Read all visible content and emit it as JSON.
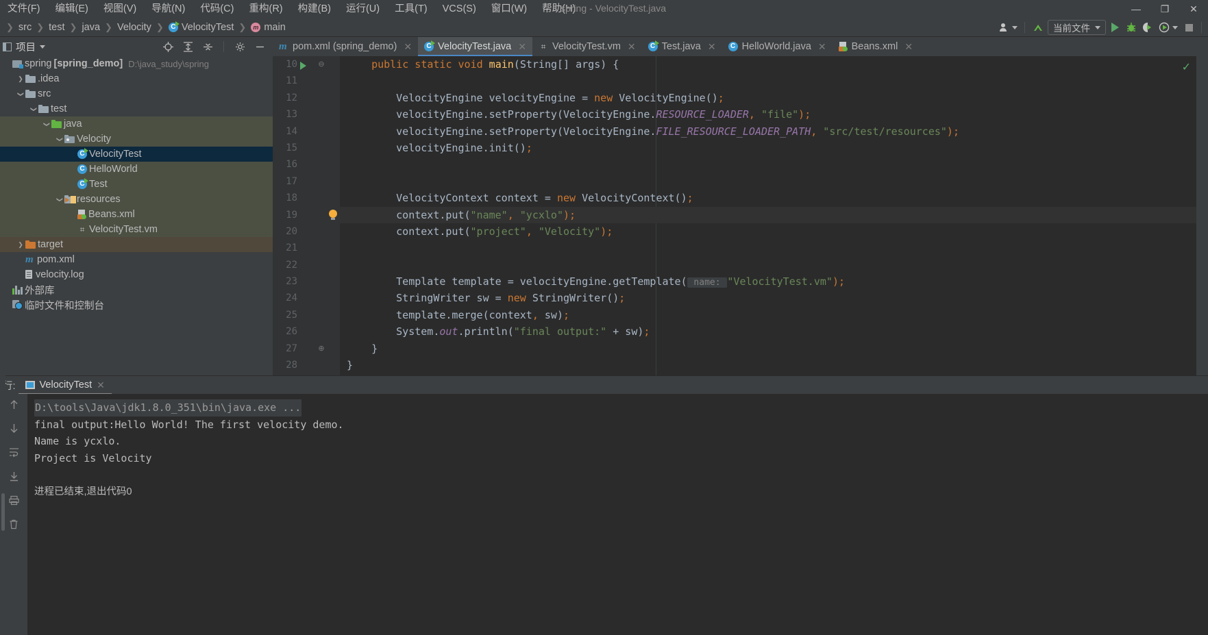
{
  "window": {
    "title": "spring - VelocityTest.java",
    "minimize": "—",
    "maximize": "❐",
    "close": "✕"
  },
  "menubar": [
    {
      "label": "文件(F)"
    },
    {
      "label": "编辑(E)"
    },
    {
      "label": "视图(V)"
    },
    {
      "label": "导航(N)"
    },
    {
      "label": "代码(C)"
    },
    {
      "label": "重构(R)"
    },
    {
      "label": "构建(B)"
    },
    {
      "label": "运行(U)"
    },
    {
      "label": "工具(T)"
    },
    {
      "label": "VCS(S)"
    },
    {
      "label": "窗口(W)"
    },
    {
      "label": "帮助(H)"
    }
  ],
  "breadcrumb": [
    {
      "label": "src",
      "icon": "none"
    },
    {
      "label": "test",
      "icon": "none"
    },
    {
      "label": "java",
      "icon": "none"
    },
    {
      "label": "Velocity",
      "icon": "none"
    },
    {
      "label": "VelocityTest",
      "icon": "class-icon"
    },
    {
      "label": "main",
      "icon": "method-icon"
    }
  ],
  "toolbar": {
    "run_config": "当前文件",
    "buttons": [
      {
        "name": "account-icon",
        "glyph": "♟"
      },
      {
        "name": "update-project-icon",
        "glyph": "↖"
      },
      {
        "name": "run-button",
        "glyph": "▶"
      },
      {
        "name": "debug-button",
        "glyph": "⚙"
      },
      {
        "name": "run-with-coverage-button",
        "glyph": "◑"
      },
      {
        "name": "profiler-button",
        "glyph": "◴"
      },
      {
        "name": "stop-button",
        "glyph": "■"
      }
    ]
  },
  "project_panel": {
    "title": "项目",
    "tree": [
      {
        "label": "spring",
        "bold_label": "[spring_demo]",
        "path": "D:\\java_study\\spring",
        "indent": 0,
        "arrow": "none",
        "icon": "project-root-icon",
        "state": "normal"
      },
      {
        "label": ".idea",
        "indent": 1,
        "arrow": "closed",
        "icon": "folder-icon",
        "state": "normal"
      },
      {
        "label": "src",
        "indent": 1,
        "arrow": "open",
        "icon": "folder-icon",
        "state": "normal"
      },
      {
        "label": "test",
        "indent": 2,
        "arrow": "open",
        "icon": "folder-icon",
        "state": "normal"
      },
      {
        "label": "java",
        "indent": 3,
        "arrow": "open",
        "icon": "folder-green-icon",
        "state": "green"
      },
      {
        "label": "Velocity",
        "indent": 4,
        "arrow": "open",
        "icon": "package-icon",
        "state": "green"
      },
      {
        "label": "VelocityTest",
        "indent": 5,
        "arrow": "none",
        "icon": "class-runnable-icon",
        "state": "selected"
      },
      {
        "label": "HelloWorld",
        "indent": 5,
        "arrow": "none",
        "icon": "class-icon",
        "state": "green"
      },
      {
        "label": "Test",
        "indent": 5,
        "arrow": "none",
        "icon": "class-runnable-icon",
        "state": "green"
      },
      {
        "label": "resources",
        "indent": 4,
        "arrow": "open",
        "icon": "resources-folder-icon",
        "state": "green"
      },
      {
        "label": "Beans.xml",
        "indent": 5,
        "arrow": "none",
        "icon": "spring-xml-icon",
        "state": "green"
      },
      {
        "label": "VelocityTest.vm",
        "indent": 5,
        "arrow": "none",
        "icon": "velocity-file-icon",
        "state": "green"
      },
      {
        "label": "target",
        "indent": 1,
        "arrow": "closed",
        "icon": "folder-orange-icon",
        "state": "brown"
      },
      {
        "label": "pom.xml",
        "indent": 1,
        "arrow": "none",
        "icon": "maven-icon",
        "state": "normal"
      },
      {
        "label": "velocity.log",
        "indent": 1,
        "arrow": "none",
        "icon": "file-icon",
        "state": "normal"
      },
      {
        "label": "外部库",
        "indent": 0,
        "arrow": "none",
        "icon": "library-icon",
        "state": "normal"
      },
      {
        "label": "临时文件和控制台",
        "indent": 0,
        "arrow": "none",
        "icon": "scratches-icon",
        "state": "normal"
      }
    ]
  },
  "editor_tabs": [
    {
      "label": "pom.xml (spring_demo)",
      "icon": "maven-icon",
      "active": false
    },
    {
      "label": "VelocityTest.java",
      "icon": "class-runnable-icon",
      "active": true
    },
    {
      "label": "VelocityTest.vm",
      "icon": "velocity-file-icon",
      "active": false
    },
    {
      "label": "Test.java",
      "icon": "class-runnable-icon",
      "active": false
    },
    {
      "label": "HelloWorld.java",
      "icon": "class-icon",
      "active": false
    },
    {
      "label": "Beans.xml",
      "icon": "spring-xml-icon",
      "active": false
    }
  ],
  "editor": {
    "close_glyph": "✕",
    "lines": [
      {
        "num": "10",
        "gutter": "run",
        "fold": "⊖",
        "indent": 4,
        "tokens": [
          {
            "t": "public ",
            "c": "k"
          },
          {
            "t": "static ",
            "c": "k"
          },
          {
            "t": "void ",
            "c": "k"
          },
          {
            "t": "main",
            "c": "fn"
          },
          {
            "t": "(String[] args) {",
            "c": "p"
          }
        ]
      },
      {
        "num": "11",
        "gutter": "",
        "fold": "",
        "indent": 0,
        "tokens": []
      },
      {
        "num": "12",
        "gutter": "",
        "fold": "",
        "indent": 8,
        "tokens": [
          {
            "t": "VelocityEngine velocityEngine = ",
            "c": "p"
          },
          {
            "t": "new ",
            "c": "k"
          },
          {
            "t": "VelocityEngine()",
            "c": "p"
          },
          {
            "t": ";",
            "c": "k"
          }
        ]
      },
      {
        "num": "13",
        "gutter": "",
        "fold": "",
        "indent": 8,
        "tokens": [
          {
            "t": "velocityEngine.setProperty(VelocityEngine.",
            "c": "p"
          },
          {
            "t": "RESOURCE_LOADER",
            "c": "st"
          },
          {
            "t": ",",
            "c": "k"
          },
          {
            "t": " ",
            "c": "p"
          },
          {
            "t": "\"file\"",
            "c": "s"
          },
          {
            "t": ");",
            "c": "k"
          }
        ]
      },
      {
        "num": "14",
        "gutter": "",
        "fold": "",
        "indent": 8,
        "tokens": [
          {
            "t": "velocityEngine.setProperty(VelocityEngine.",
            "c": "p"
          },
          {
            "t": "FILE_RESOURCE_LOADER_PATH",
            "c": "st"
          },
          {
            "t": ",",
            "c": "k"
          },
          {
            "t": " ",
            "c": "p"
          },
          {
            "t": "\"src/test/resources\"",
            "c": "s"
          },
          {
            "t": ");",
            "c": "k"
          }
        ]
      },
      {
        "num": "15",
        "gutter": "",
        "fold": "",
        "indent": 8,
        "tokens": [
          {
            "t": "velocityEngine.init()",
            "c": "p"
          },
          {
            "t": ";",
            "c": "k"
          }
        ]
      },
      {
        "num": "16",
        "gutter": "",
        "fold": "",
        "indent": 0,
        "tokens": []
      },
      {
        "num": "17",
        "gutter": "",
        "fold": "",
        "indent": 0,
        "tokens": []
      },
      {
        "num": "18",
        "gutter": "",
        "fold": "",
        "indent": 8,
        "tokens": [
          {
            "t": "VelocityContext context = ",
            "c": "p"
          },
          {
            "t": "new ",
            "c": "k"
          },
          {
            "t": "VelocityContext()",
            "c": "p"
          },
          {
            "t": ";",
            "c": "k"
          }
        ]
      },
      {
        "num": "19",
        "gutter": "bulb",
        "fold": "",
        "indent": 8,
        "tokens": [
          {
            "t": "context.put(",
            "c": "p"
          },
          {
            "t": "\"name\"",
            "c": "s"
          },
          {
            "t": ",",
            "c": "k"
          },
          {
            "t": " ",
            "c": "p"
          },
          {
            "t": "\"ycxlo\"",
            "c": "s"
          },
          {
            "t": ");",
            "c": "k"
          }
        ]
      },
      {
        "num": "20",
        "gutter": "",
        "fold": "",
        "indent": 8,
        "tokens": [
          {
            "t": "context.put(",
            "c": "p"
          },
          {
            "t": "\"project\"",
            "c": "s"
          },
          {
            "t": ",",
            "c": "k"
          },
          {
            "t": " ",
            "c": "p"
          },
          {
            "t": "\"Velocity\"",
            "c": "s"
          },
          {
            "t": ");",
            "c": "k"
          }
        ]
      },
      {
        "num": "21",
        "gutter": "",
        "fold": "",
        "indent": 0,
        "tokens": []
      },
      {
        "num": "22",
        "gutter": "",
        "fold": "",
        "indent": 0,
        "tokens": []
      },
      {
        "num": "23",
        "gutter": "",
        "fold": "",
        "indent": 8,
        "tokens": [
          {
            "t": "Template template = velocityEngine.getTemplate(",
            "c": "p"
          },
          {
            "t": " name: ",
            "c": "hint"
          },
          {
            "t": "\"VelocityTest.vm\"",
            "c": "s"
          },
          {
            "t": ");",
            "c": "k"
          }
        ]
      },
      {
        "num": "24",
        "gutter": "",
        "fold": "",
        "indent": 8,
        "tokens": [
          {
            "t": "StringWriter sw = ",
            "c": "p"
          },
          {
            "t": "new ",
            "c": "k"
          },
          {
            "t": "StringWriter()",
            "c": "p"
          },
          {
            "t": ";",
            "c": "k"
          }
        ]
      },
      {
        "num": "25",
        "gutter": "",
        "fold": "",
        "indent": 8,
        "tokens": [
          {
            "t": "template.merge(context",
            "c": "p"
          },
          {
            "t": ",",
            "c": "k"
          },
          {
            "t": " sw)",
            "c": "p"
          },
          {
            "t": ";",
            "c": "k"
          }
        ]
      },
      {
        "num": "26",
        "gutter": "",
        "fold": "",
        "indent": 8,
        "tokens": [
          {
            "t": "System.",
            "c": "p"
          },
          {
            "t": "out",
            "c": "st"
          },
          {
            "t": ".println(",
            "c": "p"
          },
          {
            "t": "\"final output:\"",
            "c": "s"
          },
          {
            "t": " + sw)",
            "c": "p"
          },
          {
            "t": ";",
            "c": "k"
          }
        ]
      },
      {
        "num": "27",
        "gutter": "",
        "fold": "⊕",
        "indent": 4,
        "tokens": [
          {
            "t": "}",
            "c": "p"
          }
        ]
      },
      {
        "num": "28",
        "gutter": "",
        "fold": "",
        "indent": 0,
        "tokens": [
          {
            "t": "}",
            "c": "p"
          }
        ]
      }
    ]
  },
  "run_panel": {
    "label": "行:",
    "tab_label": "VelocityTest",
    "close_glyph": "✕",
    "gutter_icons": [
      {
        "name": "scroll-up-icon",
        "glyph": "↑"
      },
      {
        "name": "scroll-down-icon",
        "glyph": "↓"
      },
      {
        "name": "soft-wrap-icon",
        "glyph": "↵"
      },
      {
        "name": "scroll-to-end-icon",
        "glyph": "↧"
      },
      {
        "name": "print-icon",
        "glyph": "⎙"
      },
      {
        "name": "clear-all-icon",
        "glyph": "Ὕ1"
      }
    ],
    "console_lines": [
      {
        "text": "D:\\tools\\Java\\jdk1.8.0_351\\bin\\java.exe ...",
        "style": "cmd"
      },
      {
        "text": "final output:Hello World! The first velocity demo.",
        "style": "out"
      },
      {
        "text": "Name is ycxlo.",
        "style": "out"
      },
      {
        "text": "Project is Velocity",
        "style": "out"
      },
      {
        "text": "",
        "style": "out"
      },
      {
        "text": "进程已结束,退出代码0",
        "style": "cn"
      }
    ]
  },
  "colors": {
    "accent_blue": "#4a88c7",
    "selection": "#0d293e",
    "green_highlight": "#4b5043",
    "brown_highlight": "#50483b",
    "editor_bg": "#2b2b2b",
    "panel_bg": "#3c3f41",
    "run_green": "#59a869"
  }
}
